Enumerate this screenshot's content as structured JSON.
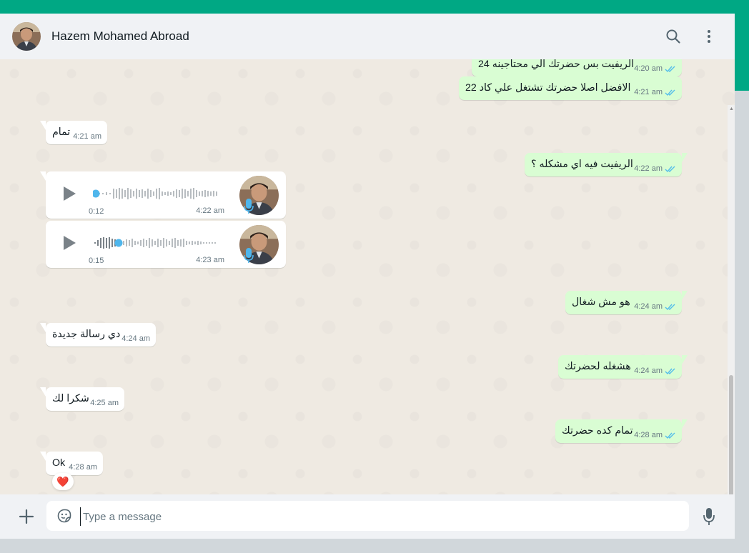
{
  "header": {
    "contact_name": "Hazem Mohamed Abroad"
  },
  "colors": {
    "accent": "#00a884",
    "outgoing_bubble": "#d9fdd3",
    "incoming_bubble": "#ffffff",
    "read_ticks": "#53bdeb",
    "chat_background": "#efeae2"
  },
  "icons": {
    "search": "search-icon",
    "menu": "kebab-menu-icon",
    "attach": "plus-icon",
    "emoji": "sticker-icon",
    "mic": "microphone-icon",
    "play": "play-icon",
    "read_status": "double-check-icon"
  },
  "messages": [
    {
      "direction": "out",
      "text": "الريفيت بس حضرتك الي محتاجينه 24",
      "time": "4:20 am",
      "status": "read"
    },
    {
      "direction": "out",
      "text": "الافضل اصلا حضرتك تشتغل علي كاد 22",
      "time": "4:21 am",
      "status": "read"
    },
    {
      "direction": "in",
      "text": "تمام",
      "time": "4:21 am"
    },
    {
      "direction": "out",
      "text": "الريفيت فيه اي مشكله ؟",
      "time": "4:22 am",
      "status": "read"
    },
    {
      "direction": "in",
      "type": "voice",
      "duration": "0:12",
      "time": "4:22 am",
      "played_fraction": 0.0
    },
    {
      "direction": "in",
      "type": "voice",
      "duration": "0:15",
      "time": "4:23 am",
      "played_fraction": 0.2
    },
    {
      "direction": "out",
      "text": "هو مش شغال",
      "time": "4:24 am",
      "status": "read"
    },
    {
      "direction": "in",
      "text": "دي رسالة جديدة",
      "time": "4:24 am"
    },
    {
      "direction": "out",
      "text": "هشغله لحضرتك",
      "time": "4:24 am",
      "status": "read"
    },
    {
      "direction": "in",
      "text": "شكرا لك",
      "time": "4:25 am"
    },
    {
      "direction": "out",
      "text": "تمام كده حضرتك",
      "time": "4:28 am",
      "status": "read"
    },
    {
      "direction": "in",
      "text": "Ok",
      "time": "4:28 am",
      "reaction": "❤️"
    }
  ],
  "composer": {
    "placeholder": "Type a message",
    "value": ""
  }
}
